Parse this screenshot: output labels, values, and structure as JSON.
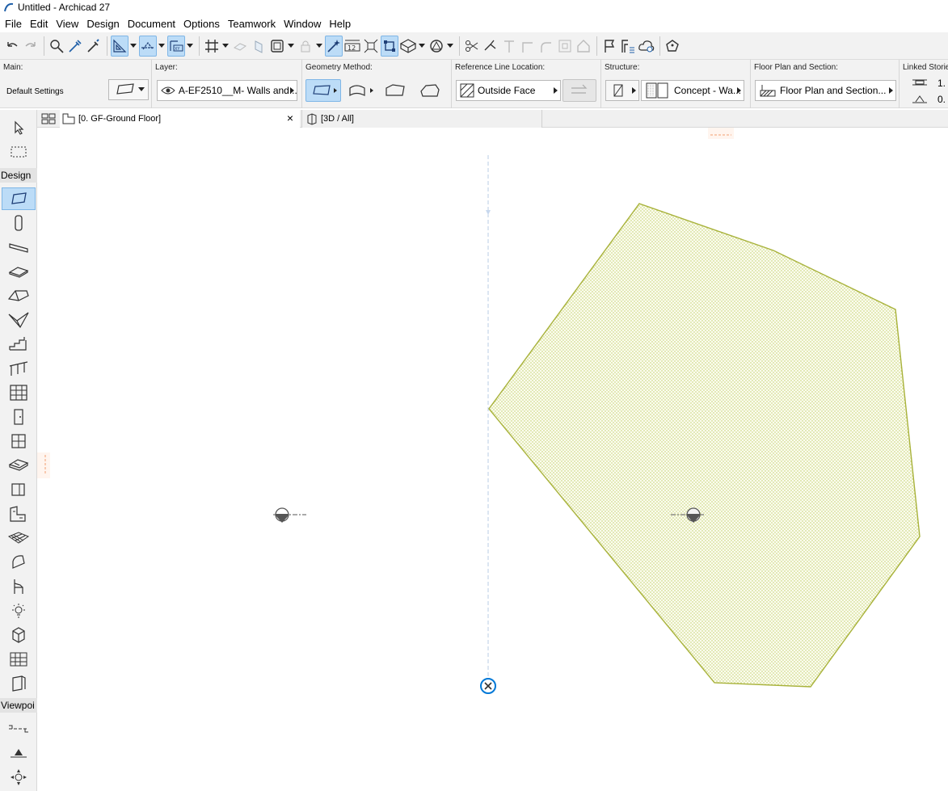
{
  "window": {
    "title": "Untitled - Archicad 27"
  },
  "menu": {
    "items": [
      "File",
      "Edit",
      "View",
      "Design",
      "Document",
      "Options",
      "Teamwork",
      "Window",
      "Help"
    ]
  },
  "infobox": {
    "main": {
      "label": "Main:",
      "settings": "Default Settings"
    },
    "layer": {
      "label": "Layer:",
      "value": "A-EF2510__M- Walls and..."
    },
    "geometry": {
      "label": "Geometry Method:"
    },
    "reference": {
      "label": "Reference Line Location:",
      "value": "Outside Face"
    },
    "structure": {
      "label": "Structure:",
      "value": "Concept - Wa..."
    },
    "floorplan": {
      "label": "Floor Plan and Section:",
      "value": "Floor Plan and Section..."
    },
    "linked": {
      "label": "Linked Stories:",
      "top_value": "1.",
      "bottom_value": "0."
    }
  },
  "tabs": {
    "floor_plan": "[0. GF-Ground Floor]",
    "close_glyph": "×",
    "view3d": "[3D / All]"
  },
  "toolbox": {
    "design_header": "Design",
    "viewpoint_header": "Viewpoi"
  },
  "colors": {
    "accent": "#0078d7",
    "fill_pattern": "#b5c44a",
    "outline": "#a8b23a",
    "active_tool": "#bcdcf7"
  }
}
